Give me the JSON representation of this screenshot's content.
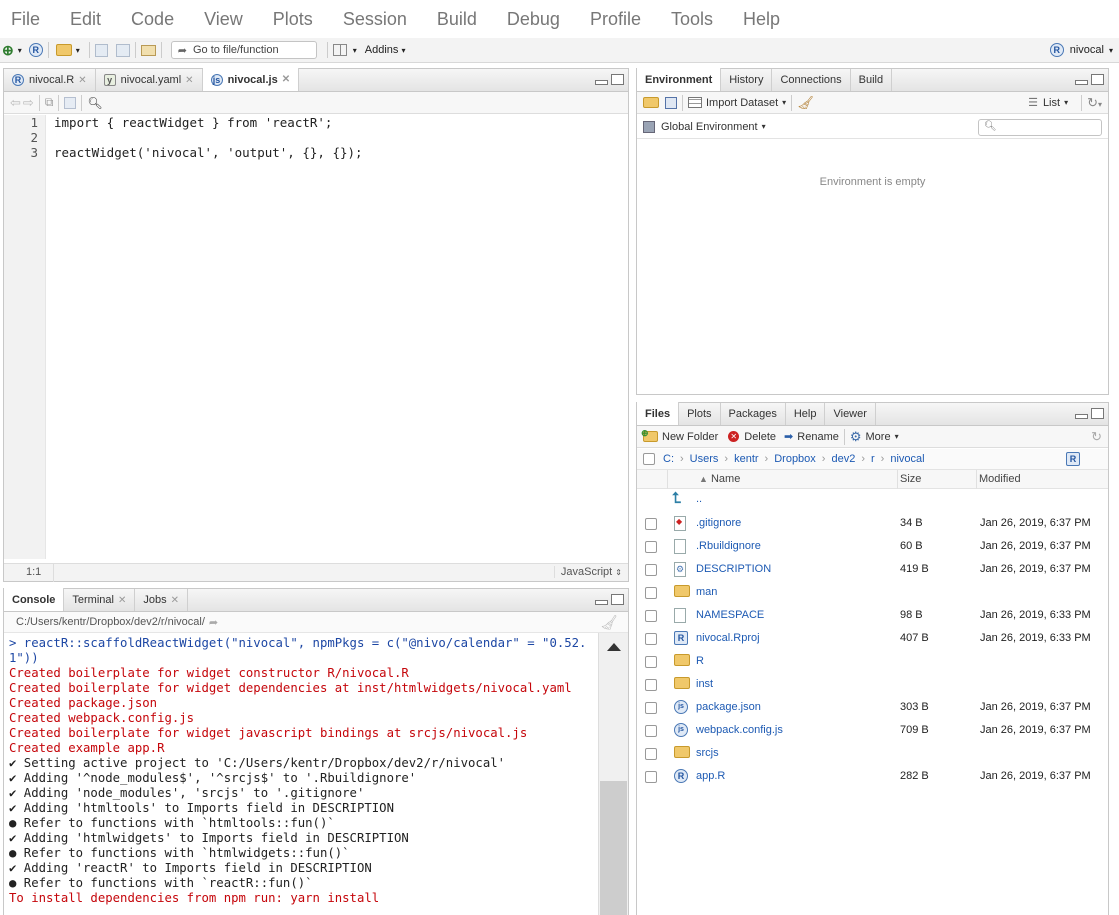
{
  "menu": [
    "File",
    "Edit",
    "Code",
    "View",
    "Plots",
    "Session",
    "Build",
    "Debug",
    "Profile",
    "Tools",
    "Help"
  ],
  "toolbar": {
    "goto_placeholder": "Go to file/function",
    "addins": "Addins",
    "project": "nivocal"
  },
  "editor": {
    "tabs": [
      {
        "label": "nivocal.R"
      },
      {
        "label": "nivocal.yaml"
      },
      {
        "label": "nivocal.js"
      }
    ],
    "active_tab": 2,
    "lines": [
      "import { reactWidget } from 'reactR';",
      "",
      "reactWidget('nivocal', 'output', {}, {});"
    ],
    "line_numbers": [
      "1",
      "2",
      "3"
    ],
    "cursor_pos": "1:1",
    "file_type": "JavaScript"
  },
  "console": {
    "tabs": [
      {
        "label": "Console"
      },
      {
        "label": "Terminal"
      },
      {
        "label": "Jobs"
      }
    ],
    "path": "C:/Users/kentr/Dropbox/dev2/r/nivocal/",
    "lines": [
      {
        "cls": "cblue",
        "text": "> reactR::scaffoldReactWidget(\"nivocal\", npmPkgs = c(\"@nivo/calendar\" = \"0.52.1\"))"
      },
      {
        "cls": "cred",
        "text": "Created boilerplate for widget constructor R/nivocal.R"
      },
      {
        "cls": "cred",
        "text": "Created boilerplate for widget dependencies at inst/htmlwidgets/nivocal.yaml"
      },
      {
        "cls": "cred",
        "text": "Created package.json"
      },
      {
        "cls": "cred",
        "text": "Created webpack.config.js"
      },
      {
        "cls": "cred",
        "text": "Created boilerplate for widget javascript bindings at srcjs/nivocal.js"
      },
      {
        "cls": "cred",
        "text": "Created example app.R"
      },
      {
        "cls": "cblk",
        "text": "✔ Setting active project to 'C:/Users/kentr/Dropbox/dev2/r/nivocal'"
      },
      {
        "cls": "cblk",
        "text": "✔ Adding '^node_modules$', '^srcjs$' to '.Rbuildignore'"
      },
      {
        "cls": "cblk",
        "text": "✔ Adding 'node_modules', 'srcjs' to '.gitignore'"
      },
      {
        "cls": "cblk",
        "text": "✔ Adding 'htmltools' to Imports field in DESCRIPTION"
      },
      {
        "cls": "cblk",
        "text": "● Refer to functions with `htmltools::fun()`"
      },
      {
        "cls": "cblk",
        "text": "✔ Adding 'htmlwidgets' to Imports field in DESCRIPTION"
      },
      {
        "cls": "cblk",
        "text": "● Refer to functions with `htmlwidgets::fun()`"
      },
      {
        "cls": "cblk",
        "text": "✔ Adding 'reactR' to Imports field in DESCRIPTION"
      },
      {
        "cls": "cblk",
        "text": "● Refer to functions with `reactR::fun()`"
      },
      {
        "cls": "cred",
        "text": "To install dependencies from npm run: yarn install"
      }
    ]
  },
  "env": {
    "tabs": [
      {
        "label": "Environment"
      },
      {
        "label": "History"
      },
      {
        "label": "Connections"
      },
      {
        "label": "Build"
      }
    ],
    "import_dataset": "Import Dataset",
    "list_label": "List",
    "scope": "Global Environment",
    "empty_msg": "Environment is empty"
  },
  "files": {
    "tabs": [
      {
        "label": "Files"
      },
      {
        "label": "Plots"
      },
      {
        "label": "Packages"
      },
      {
        "label": "Help"
      },
      {
        "label": "Viewer"
      }
    ],
    "new_folder": "New Folder",
    "delete": "Delete",
    "rename": "Rename",
    "more": "More",
    "breadcrumb": [
      "C:",
      "Users",
      "kentr",
      "Dropbox",
      "dev2",
      "r",
      "nivocal"
    ],
    "col_name": "Name",
    "col_size": "Size",
    "col_modified": "Modified",
    "parent": "..",
    "rows": [
      {
        "name": ".gitignore",
        "size": "34 B",
        "modified": "Jan 26, 2019, 6:37 PM",
        "icon": "git"
      },
      {
        "name": ".Rbuildignore",
        "size": "60 B",
        "modified": "Jan 26, 2019, 6:37 PM",
        "icon": "doc"
      },
      {
        "name": "DESCRIPTION",
        "size": "419 B",
        "modified": "Jan 26, 2019, 6:37 PM",
        "icon": "gear"
      },
      {
        "name": "man",
        "size": "",
        "modified": "",
        "icon": "folder"
      },
      {
        "name": "NAMESPACE",
        "size": "98 B",
        "modified": "Jan 26, 2019, 6:33 PM",
        "icon": "doc"
      },
      {
        "name": "nivocal.Rproj",
        "size": "407 B",
        "modified": "Jan 26, 2019, 6:33 PM",
        "icon": "rproj"
      },
      {
        "name": "R",
        "size": "",
        "modified": "",
        "icon": "folder"
      },
      {
        "name": "inst",
        "size": "",
        "modified": "",
        "icon": "folder"
      },
      {
        "name": "package.json",
        "size": "303 B",
        "modified": "Jan 26, 2019, 6:37 PM",
        "icon": "js"
      },
      {
        "name": "webpack.config.js",
        "size": "709 B",
        "modified": "Jan 26, 2019, 6:37 PM",
        "icon": "js"
      },
      {
        "name": "srcjs",
        "size": "",
        "modified": "",
        "icon": "folder"
      },
      {
        "name": "app.R",
        "size": "282 B",
        "modified": "Jan 26, 2019, 6:37 PM",
        "icon": "r"
      }
    ]
  }
}
